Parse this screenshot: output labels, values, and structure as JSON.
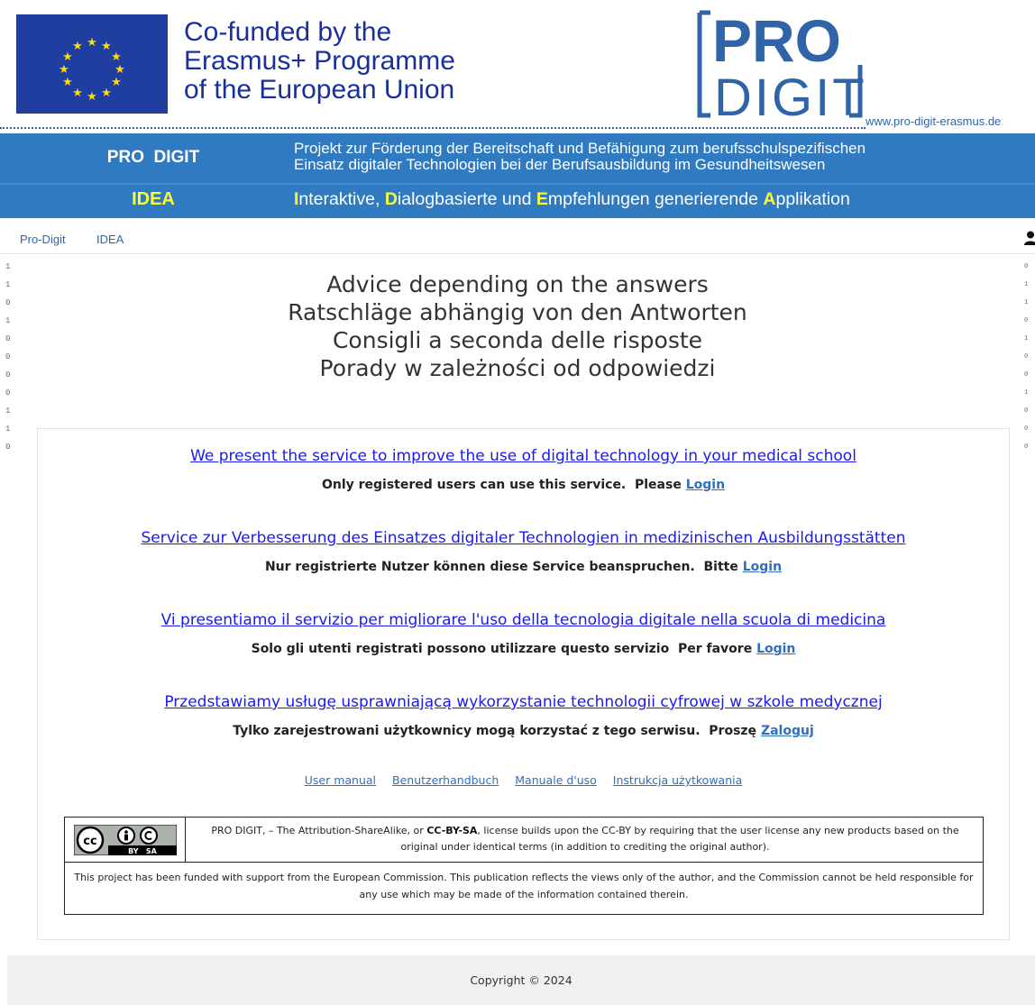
{
  "header": {
    "cofunded_lines": [
      "Co-funded by the",
      "Erasmus+ Programme",
      "of the European Union"
    ],
    "logo_pro": "PRO",
    "logo_digit": "DIGIT",
    "site_url": "www.pro-digit-erasmus.de",
    "pro_digit_label": "PRO  DIGIT",
    "project_desc_line1": "Projekt zur Förderung der Bereitschaft und Befähigung zum berufsschulspezifischen",
    "project_desc_line2": "Einsatz digitaler Technologien bei der Berufsausbildung im Gesundheitswesen",
    "idea_label": "IDEA",
    "idea_desc": [
      {
        "hl": "I",
        "rest": "nteraktive, "
      },
      {
        "hl": "D",
        "rest": "ialogbasierte und "
      },
      {
        "hl": "E",
        "rest": "mpfehlungen generierende "
      },
      {
        "hl": "A",
        "rest": "pplikation"
      }
    ]
  },
  "nav": {
    "items": [
      "Pro-Digit",
      "IDEA"
    ],
    "user_icon": "user-icon"
  },
  "side_digits": {
    "left": [
      "1",
      "1",
      "0",
      "1",
      "0",
      "0",
      "0",
      "0",
      "1",
      "1",
      "0"
    ],
    "right": [
      "0",
      "1",
      "1",
      "0",
      "1",
      "0",
      "0",
      "1",
      "0",
      "0",
      "0"
    ]
  },
  "headings": [
    "Advice depending on the answers",
    "Ratschläge abhängig von den Antworten",
    "Consigli a seconda delle risposte",
    "Porady w zależności od odpowiedzi"
  ],
  "services": [
    {
      "link": "We present the service to improve the use of digital technology in your medical school",
      "note": "Only registered users can use this service.  Please ",
      "login": "Login"
    },
    {
      "link": "Service zur Verbesserung des Einsatzes digitaler Technologien in medizinischen Ausbildungsstätten",
      "note": "Nur registrierte Nutzer können diese Service beanspruchen.  Bitte ",
      "login": "Login"
    },
    {
      "link": "Vi presentiamo il servizio per migliorare l'uso della tecnologia digitale nella scuola di medicina",
      "note": "Solo gli utenti registrati possono utilizzare questo servizio  Per favore ",
      "login": "Login"
    },
    {
      "link": "Przedstawiamy usługę usprawniającą wykorzystanie technologii cyfrowej w szkole medycznej",
      "note": "Tylko zarejestrowani użytkownicy mogą korzystać z tego serwisu.  Proszę ",
      "login": "Zaloguj"
    }
  ],
  "manuals": [
    "User manual",
    "Benutzerhandbuch",
    "Manuale d'uso",
    "Instrukcja użytkowania"
  ],
  "license": {
    "badge_text": "BY   SA",
    "badge_cc": "cc",
    "text_prefix": "PRO DIGIT, – The Attribution-ShareAlike, or ",
    "text_bold": "CC-BY-SA",
    "text_suffix": ", license builds upon the CC-BY by requiring that the user license any new products based on the original under identical terms (in addition to crediting the original author).",
    "disclaimer": "This project has been funded with support from the European Commission. This publication reflects the views only of the author, and the Commission cannot be held responsible for any use which may be made of the information contained therein."
  },
  "footer": {
    "copyright": "Copyright © 2024"
  },
  "colors": {
    "banner_blue": "#2f7ac0",
    "highlight_yellow": "#ffff33",
    "eu_blue": "#1f3ea0",
    "link_blue": "#1a1aee"
  }
}
